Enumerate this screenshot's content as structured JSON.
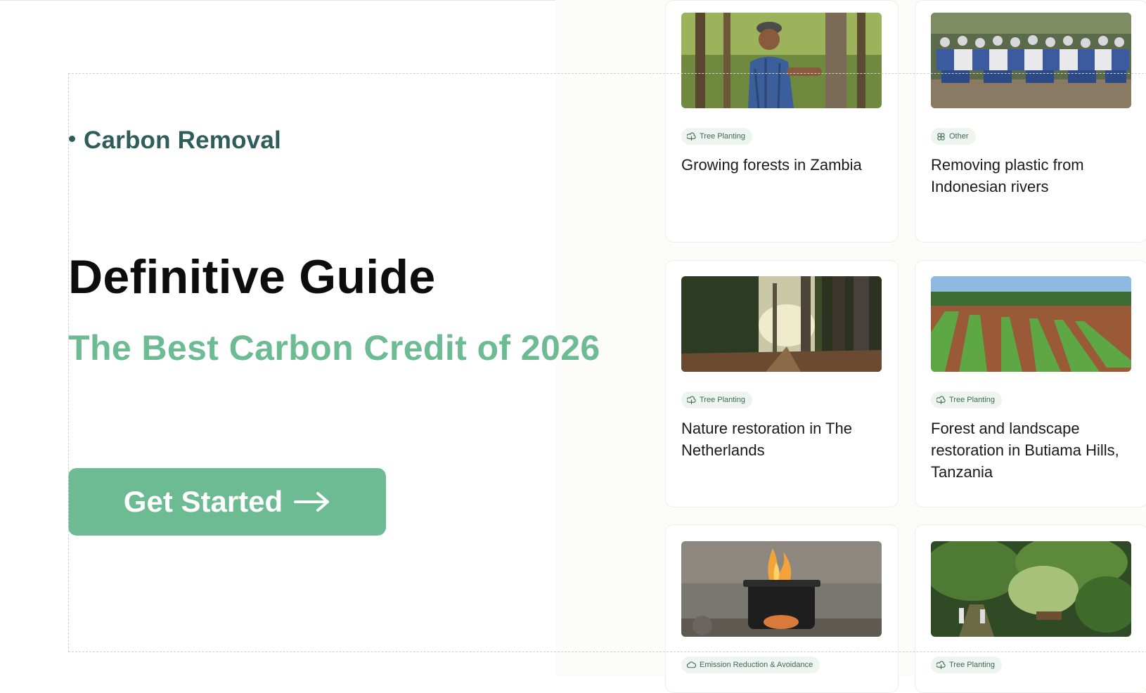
{
  "hero": {
    "eyebrow": "Carbon Removal",
    "title": "Definitive Guide",
    "subtitle": "The Best Carbon Credit of 2026",
    "cta_label": "Get Started"
  },
  "projects": [
    {
      "title": "Growing forests in Zambia",
      "tag": "Tree Planting",
      "tag_icon": "tree-planting-icon",
      "image": "person-measuring-tree-photo"
    },
    {
      "title": "Removing plastic from Indonesian rivers",
      "tag": "Other",
      "tag_icon": "other-icon",
      "image": "group-photo"
    },
    {
      "title": "Nature restoration in The Netherlands",
      "tag": "Tree Planting",
      "tag_icon": "tree-planting-icon",
      "image": "forest-path-photo"
    },
    {
      "title": "Forest and landscape restoration in Butiama Hills, Tanzania",
      "tag": "Tree Planting",
      "tag_icon": "tree-planting-icon",
      "image": "nursery-beds-photo"
    },
    {
      "title": "",
      "tag": "Emission Reduction & Avoidance",
      "tag_icon": "emission-reduction-icon",
      "image": "cookstove-fire-photo"
    },
    {
      "title": "",
      "tag": "Tree Planting",
      "tag_icon": "tree-planting-icon",
      "image": "jungle-trail-photo"
    }
  ],
  "colors": {
    "accent": "#6cbb93",
    "eyebrow": "#2f5d5a",
    "tag_bg": "#eef4ef",
    "tag_text": "#3c6c56"
  }
}
